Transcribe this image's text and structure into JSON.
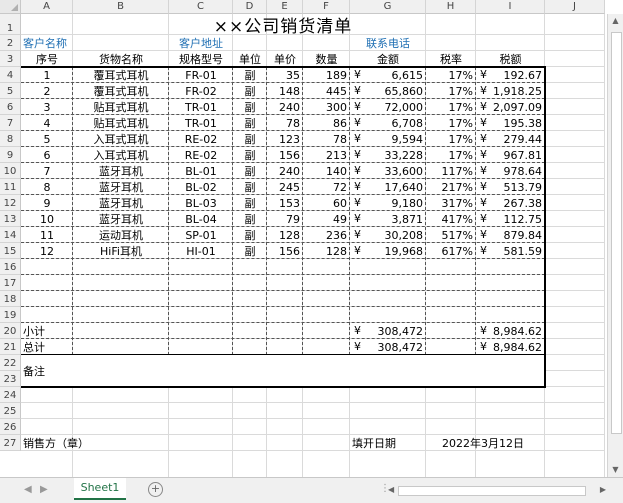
{
  "app": {
    "columns": [
      "A",
      "B",
      "C",
      "D",
      "E",
      "F",
      "G",
      "H",
      "I",
      "J"
    ],
    "rows": [
      "1",
      "2",
      "3",
      "4",
      "5",
      "6",
      "7",
      "8",
      "9",
      "10",
      "11",
      "12",
      "13",
      "14",
      "15",
      "16",
      "17",
      "18",
      "19",
      "20",
      "21",
      "22",
      "23",
      "24",
      "25",
      "26",
      "27"
    ]
  },
  "sheet": {
    "title": "××公司销货清单",
    "info": {
      "customer_name_label": "客户名称",
      "customer_address_label": "客户地址",
      "contact_phone_label": "联系电话"
    },
    "headers": [
      "序号",
      "货物名称",
      "规格型号",
      "单位",
      "单价",
      "数量",
      "金额",
      "税率",
      "税额"
    ],
    "items": [
      {
        "no": "1",
        "name": "覆耳式耳机",
        "model": "FR-01",
        "unit": "副",
        "price": "35",
        "qty": "189",
        "amount": "6,615",
        "rate": "17%",
        "tax": "192.67"
      },
      {
        "no": "2",
        "name": "覆耳式耳机",
        "model": "FR-02",
        "unit": "副",
        "price": "148",
        "qty": "445",
        "amount": "65,860",
        "rate": "17%",
        "tax": "1,918.25"
      },
      {
        "no": "3",
        "name": "贴耳式耳机",
        "model": "TR-01",
        "unit": "副",
        "price": "240",
        "qty": "300",
        "amount": "72,000",
        "rate": "17%",
        "tax": "2,097.09"
      },
      {
        "no": "4",
        "name": "贴耳式耳机",
        "model": "TR-01",
        "unit": "副",
        "price": "78",
        "qty": "86",
        "amount": "6,708",
        "rate": "17%",
        "tax": "195.38"
      },
      {
        "no": "5",
        "name": "入耳式耳机",
        "model": "RE-02",
        "unit": "副",
        "price": "123",
        "qty": "78",
        "amount": "9,594",
        "rate": "17%",
        "tax": "279.44"
      },
      {
        "no": "6",
        "name": "入耳式耳机",
        "model": "RE-02",
        "unit": "副",
        "price": "156",
        "qty": "213",
        "amount": "33,228",
        "rate": "17%",
        "tax": "967.81"
      },
      {
        "no": "7",
        "name": "蓝牙耳机",
        "model": "BL-01",
        "unit": "副",
        "price": "240",
        "qty": "140",
        "amount": "33,600",
        "rate": "117%",
        "tax": "978.64"
      },
      {
        "no": "8",
        "name": "蓝牙耳机",
        "model": "BL-02",
        "unit": "副",
        "price": "245",
        "qty": "72",
        "amount": "17,640",
        "rate": "217%",
        "tax": "513.79"
      },
      {
        "no": "9",
        "name": "蓝牙耳机",
        "model": "BL-03",
        "unit": "副",
        "price": "153",
        "qty": "60",
        "amount": "9,180",
        "rate": "317%",
        "tax": "267.38"
      },
      {
        "no": "10",
        "name": "蓝牙耳机",
        "model": "BL-04",
        "unit": "副",
        "price": "79",
        "qty": "49",
        "amount": "3,871",
        "rate": "417%",
        "tax": "112.75"
      },
      {
        "no": "11",
        "name": "运动耳机",
        "model": "SP-01",
        "unit": "副",
        "price": "128",
        "qty": "236",
        "amount": "30,208",
        "rate": "517%",
        "tax": "879.84"
      },
      {
        "no": "12",
        "name": "HiFi耳机",
        "model": "HI-01",
        "unit": "副",
        "price": "156",
        "qty": "128",
        "amount": "19,968",
        "rate": "617%",
        "tax": "581.59"
      }
    ],
    "currency_symbol": "¥",
    "subtotal": {
      "label": "小计",
      "amount": "308,472",
      "tax": "8,984.62"
    },
    "total": {
      "label": "总计",
      "amount": "308,472",
      "tax": "8,984.62"
    },
    "remarks_label": "备注",
    "seller_label": "销售方（章）",
    "fill_date_label": "填开日期",
    "fill_date": "2022年3月12日"
  },
  "tabs": {
    "sheet1": "Sheet1",
    "add_icon": "plus-circle-icon",
    "prev_icon": "triangle-left-icon",
    "next_icon": "triangle-right-icon"
  },
  "colors": {
    "label_blue": "#1f6fb3",
    "sheet_tab_green": "#217346"
  }
}
